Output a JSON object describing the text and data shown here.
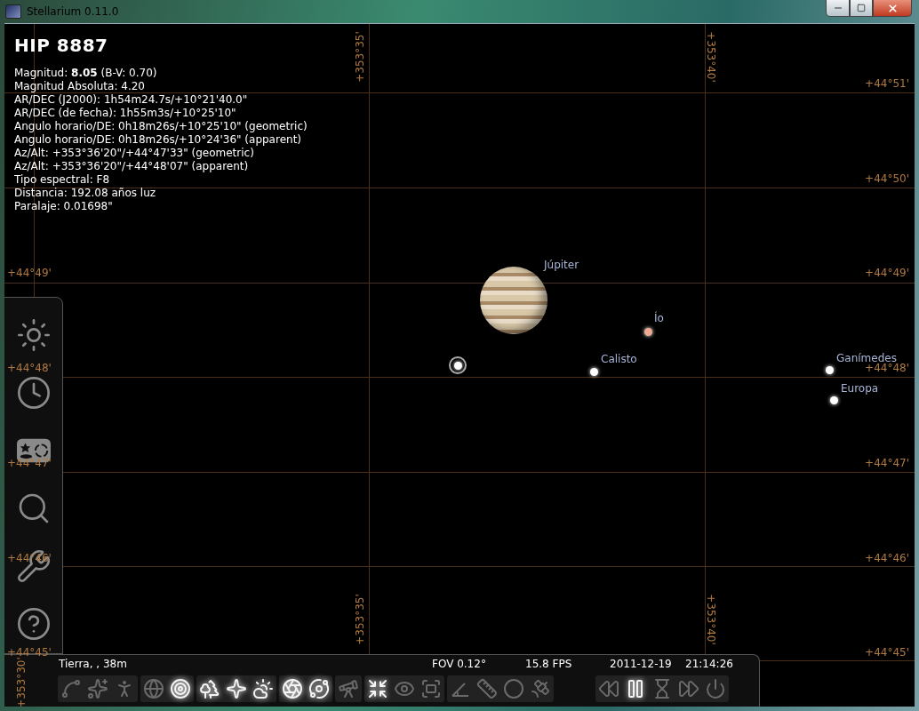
{
  "window": {
    "title": "Stellarium 0.11.0"
  },
  "selected_object": {
    "title": "HIP 8887",
    "details": [
      "Magnitud: **8.05** (B-V: 0.70)",
      "Magnitud Absoluta: 4.20",
      "AR/DEC (J2000): 1h54m24.7s/+10°21'40.0\"",
      "AR/DEC (de fecha): 1h55m3s/+10°25'10\"",
      "Angulo horario/DE: 0h18m26s/+10°25'10\" (geometric)",
      "Angulo horario/DE: 0h18m26s/+10°24'36\" (apparent)",
      "Az/Alt: +353°36'20\"/+44°47'33\" (geometric)",
      "Az/Alt: +353°36'20\"/+44°48'07\" (apparent)",
      "Tipo espectral: F8",
      "Distancia: 192.08 años luz",
      "Paralaje: 0.01698\""
    ]
  },
  "grid": {
    "altitude_labels_right": [
      "+44°51'",
      "+44°50'",
      "+44°49'",
      "+44°48'",
      "+44°47'",
      "+44°46'",
      "+44°45'"
    ],
    "altitude_labels_left": [
      "+44°49'",
      "+44°48'",
      "+44°47'",
      "+44°46'",
      "+44°45'"
    ],
    "azimuth_labels_top": [
      "+353°35'",
      "+353°40'"
    ],
    "azimuth_labels_bottom": [
      "+353°30'",
      "+353°35'",
      "+353°40'"
    ]
  },
  "objects": [
    {
      "kind": "planet",
      "label": "Júpiter",
      "color": "#d8c8a8"
    },
    {
      "kind": "moon",
      "label": "Ío",
      "color": "#f0a890"
    },
    {
      "kind": "moon",
      "label": "Calisto",
      "color": "#ffffff"
    },
    {
      "kind": "moon",
      "label": "Ganímedes",
      "color": "#ffffff"
    },
    {
      "kind": "moon",
      "label": "Europa",
      "color": "#ffffff"
    }
  ],
  "left_toolbar": {
    "buttons": [
      {
        "kind": "location"
      },
      {
        "kind": "time"
      },
      {
        "kind": "sky"
      },
      {
        "kind": "search"
      },
      {
        "kind": "settings"
      },
      {
        "kind": "help"
      }
    ]
  },
  "status": {
    "location": "Tierra, , 38m",
    "fov": "FOV 0.12°",
    "fps": "15.8 FPS",
    "date": "2011-12-19",
    "time": "21:14:26"
  },
  "bottom_toolbar": {
    "groups": [
      {
        "buttons": [
          {
            "kind": "constellation-lines",
            "on": false
          },
          {
            "kind": "constellation-labels",
            "on": false
          },
          {
            "kind": "constellation-art",
            "on": false
          }
        ]
      },
      {
        "buttons": [
          {
            "kind": "azimuthal-grid",
            "on": false
          },
          {
            "kind": "equatorial-grid",
            "on": true
          }
        ]
      },
      {
        "buttons": [
          {
            "kind": "ground",
            "on": true
          },
          {
            "kind": "cardinal",
            "on": true
          },
          {
            "kind": "atmosphere",
            "on": true
          }
        ]
      },
      {
        "buttons": [
          {
            "kind": "nebulae",
            "on": true
          },
          {
            "kind": "planets",
            "on": true
          }
        ]
      },
      {
        "buttons": [
          {
            "kind": "mount",
            "on": false
          }
        ]
      },
      {
        "buttons": [
          {
            "kind": "center",
            "on": true
          },
          {
            "kind": "night",
            "on": false
          },
          {
            "kind": "fullscreen",
            "on": false
          }
        ]
      },
      {
        "buttons": [
          {
            "kind": "angle",
            "on": false
          },
          {
            "kind": "ruler",
            "on": false
          },
          {
            "kind": "circle",
            "on": false
          },
          {
            "kind": "satellite",
            "on": false
          }
        ]
      },
      {
        "buttons": [
          {
            "kind": "rewind",
            "on": false
          },
          {
            "kind": "pause",
            "on": true
          },
          {
            "kind": "realtime",
            "on": false
          },
          {
            "kind": "forward",
            "on": false
          },
          {
            "kind": "quit",
            "on": false
          }
        ]
      }
    ]
  }
}
